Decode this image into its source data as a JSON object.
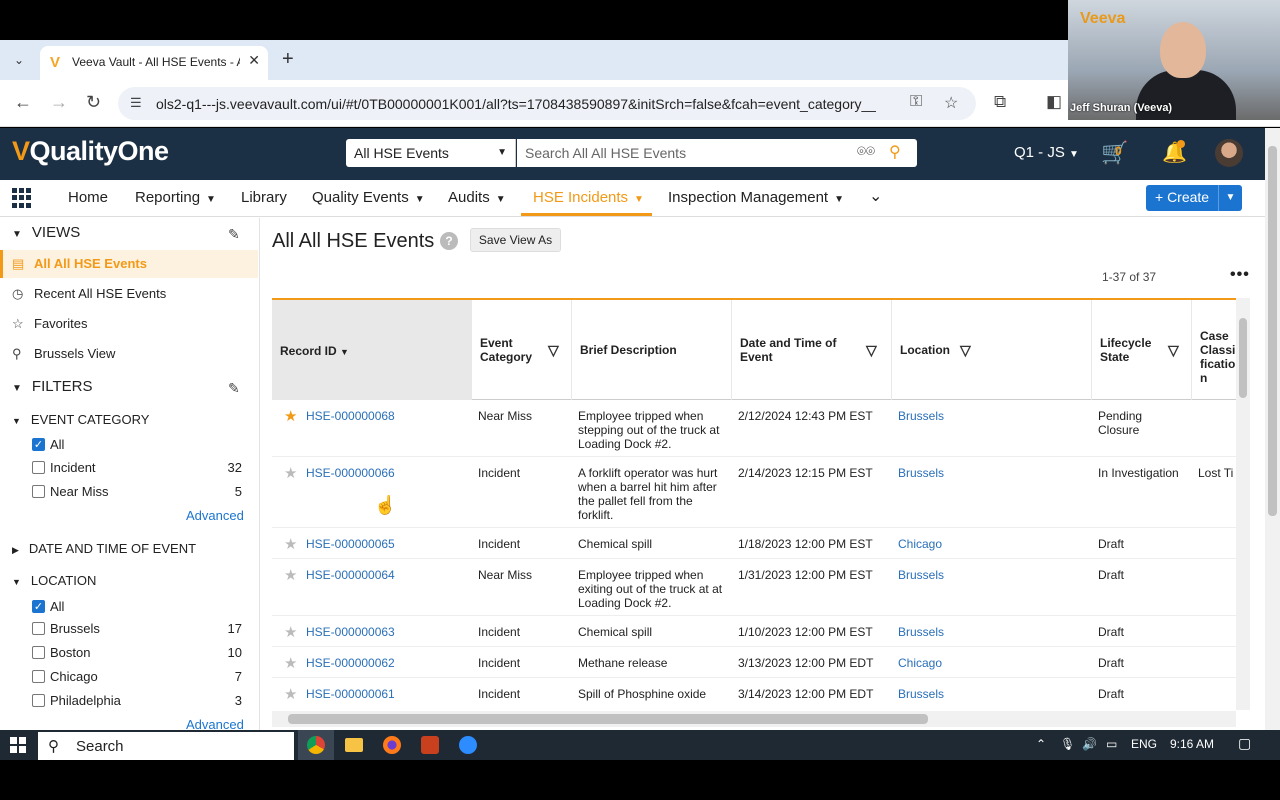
{
  "browser": {
    "tab_title": "Veeva Vault - All HSE Events - A",
    "url": "ols2-q1---js.veevavault.com/ui/#t/0TB00000001K001/all?ts=1708438590897&initSrch=false&fcah=event_category__v%..."
  },
  "video": {
    "brand": "Veeva",
    "participant": "Jeff Shuran (Veeva)"
  },
  "app": {
    "logo_v": "V",
    "logo_text": "QualityOne",
    "search_scope": "All HSE Events",
    "search_placeholder": "Search All All HSE Events",
    "vault": "Q1 - JS",
    "cart_count": "0"
  },
  "nav": {
    "items": [
      "Home",
      "Reporting",
      "Library",
      "Quality Events",
      "Audits",
      "HSE Incidents",
      "Inspection Management"
    ],
    "active": "HSE Incidents",
    "create": "+ Create"
  },
  "sidebar": {
    "views_title": "VIEWS",
    "views": [
      "All All HSE Events",
      "Recent All HSE Events",
      "Favorites",
      "Brussels View"
    ],
    "filters_title": "FILTERS",
    "event_category": {
      "title": "EVENT CATEGORY",
      "options": [
        {
          "label": "All",
          "count": ""
        },
        {
          "label": "Incident",
          "count": "32"
        },
        {
          "label": "Near Miss",
          "count": "5"
        }
      ],
      "advanced": "Advanced"
    },
    "date_time": {
      "title": "DATE AND TIME OF EVENT"
    },
    "location": {
      "title": "LOCATION",
      "options": [
        {
          "label": "All",
          "count": ""
        },
        {
          "label": "Brussels",
          "count": "17"
        },
        {
          "label": "Boston",
          "count": "10"
        },
        {
          "label": "Chicago",
          "count": "7"
        },
        {
          "label": "Philadelphia",
          "count": "3"
        }
      ],
      "advanced": "Advanced"
    }
  },
  "main": {
    "title": "All All HSE Events",
    "save_view": "Save View As",
    "count": "1-37 of 37",
    "columns": [
      "Record ID",
      "Event Category",
      "Brief Description",
      "Date and Time of Event",
      "Location",
      "Lifecycle State",
      "Case Classification"
    ],
    "rows": [
      {
        "id": "HSE-000000068",
        "category": "Near Miss",
        "desc": "Employee tripped when stepping out of the truck at Loading Dock #2.",
        "date": "2/12/2024 12:43 PM EST",
        "location": "Brussels",
        "state": "Pending Closure",
        "case": ""
      },
      {
        "id": "HSE-000000066",
        "category": "Incident",
        "desc": "A forklift operator was hurt when a barrel hit him after the pallet fell from the forklift.",
        "date": "2/14/2023 12:15 PM EST",
        "location": "Brussels",
        "state": "In Investigation",
        "case": "Lost Ti"
      },
      {
        "id": "HSE-000000065",
        "category": "Incident",
        "desc": "Chemical spill",
        "date": "1/18/2023 12:00 PM EST",
        "location": "Chicago",
        "state": "Draft",
        "case": ""
      },
      {
        "id": "HSE-000000064",
        "category": "Near Miss",
        "desc": "Employee tripped when exiting out of the truck at at Loading Dock #2.",
        "date": "1/31/2023 12:00 PM EST",
        "location": "Brussels",
        "state": "Draft",
        "case": ""
      },
      {
        "id": "HSE-000000063",
        "category": "Incident",
        "desc": "Chemical spill",
        "date": "1/10/2023 12:00 PM EST",
        "location": "Brussels",
        "state": "Draft",
        "case": ""
      },
      {
        "id": "HSE-000000062",
        "category": "Incident",
        "desc": "Methane release",
        "date": "3/13/2023 12:00 PM EDT",
        "location": "Chicago",
        "state": "Draft",
        "case": ""
      },
      {
        "id": "HSE-000000061",
        "category": "Incident",
        "desc": "Spill of Phosphine oxide",
        "date": "3/14/2023 12:00 PM EDT",
        "location": "Brussels",
        "state": "Draft",
        "case": ""
      }
    ]
  },
  "taskbar": {
    "search": "Search",
    "lang": "ENG",
    "time": "9:16 AM"
  },
  "colors": {
    "accent": "#f29a17",
    "header": "#1c3045",
    "link": "#2a6fb8",
    "primary": "#1b75d0"
  }
}
